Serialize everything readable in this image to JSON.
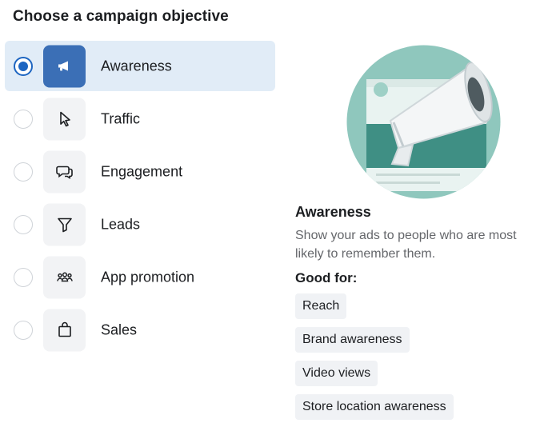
{
  "header": {
    "title": "Choose a campaign objective"
  },
  "objectives": [
    {
      "label": "Awareness",
      "icon": "megaphone-icon",
      "selected": true
    },
    {
      "label": "Traffic",
      "icon": "cursor-icon",
      "selected": false
    },
    {
      "label": "Engagement",
      "icon": "chat-bubbles-icon",
      "selected": false
    },
    {
      "label": "Leads",
      "icon": "funnel-icon",
      "selected": false
    },
    {
      "label": "App promotion",
      "icon": "people-group-icon",
      "selected": false
    },
    {
      "label": "Sales",
      "icon": "shopping-bag-icon",
      "selected": false
    }
  ],
  "detail": {
    "title": "Awareness",
    "description": "Show your ads to people who are most likely to remember them.",
    "good_for_label": "Good for:",
    "good_for": [
      "Reach",
      "Brand awareness",
      "Video views",
      "Store location awareness"
    ]
  },
  "colors": {
    "accent": "#1d65c1",
    "selected_bg": "#e1ecf7",
    "selected_icon_bg": "#3b6fb6",
    "illustration_teal": "#8fc7bd"
  }
}
